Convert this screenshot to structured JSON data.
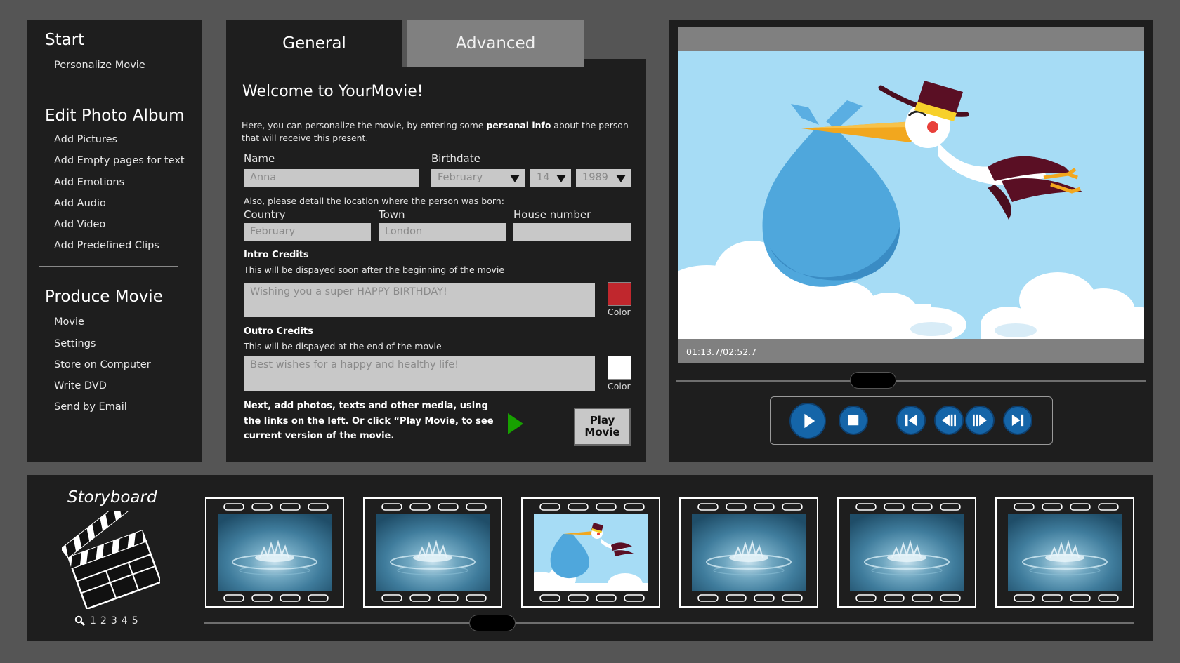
{
  "nav": {
    "start": {
      "title": "Start",
      "items": [
        "Personalize Movie"
      ]
    },
    "album": {
      "title": "Edit Photo Album",
      "items": [
        "Add Pictures",
        "Add Empty pages for text",
        "Add Emotions",
        "Add Audio",
        "Add Video",
        "Add Predefined Clips"
      ]
    },
    "produce": {
      "title": "Produce Movie",
      "items": [
        "Movie",
        "Settings",
        "Store on Computer",
        "Write DVD",
        "Send by Email"
      ]
    }
  },
  "tabs": {
    "general": "General",
    "advanced": "Advanced"
  },
  "form": {
    "welcome": "Welcome to YourMovie!",
    "intro_pre": "Here, you can personalize the movie, by entering some ",
    "intro_bold": "personal info",
    "intro_post": " about the person that will receive this present.",
    "name_label": "Name",
    "name_value": "Anna",
    "birthdate_label": "Birthdate",
    "birth_month": "February",
    "birth_day": "14",
    "birth_year": "1989",
    "location_note": "Also, please detail the location where the person was born:",
    "country_label": "Country",
    "country_value": "February",
    "town_label": "Town",
    "town_value": "London",
    "house_label": "House number",
    "house_value": "",
    "intro_credits_label": "Intro Credits",
    "intro_credits_note": "This will be dispayed soon after the beginning of the movie",
    "intro_credits_text": "Wishing you a super HAPPY BIRTHDAY!",
    "intro_color": "#c0272d",
    "outro_credits_label": "Outro Credits",
    "outro_credits_note": "This will be dispayed at the end of the movie",
    "outro_credits_text": "Best wishes for a happy and healthy life!",
    "outro_color": "#ffffff",
    "color_label": "Color",
    "next_text": "Next, add photos, texts and other media, using the links on the left. Or click “Play Movie, to see current version of the movie.",
    "play_movie_line1": "Play",
    "play_movie_line2": "Movie"
  },
  "player": {
    "time": "01:13.7/02:52.7",
    "position_fraction": 0.41,
    "controls": [
      "play-icon",
      "stop-icon",
      "skip-back-icon",
      "step-back-icon",
      "step-forward-icon",
      "skip-forward-icon"
    ]
  },
  "storyboard": {
    "title": "Storyboard",
    "zoom_levels": [
      "1",
      "2",
      "3",
      "4",
      "5"
    ],
    "frames": [
      "water",
      "water",
      "stork",
      "water",
      "water",
      "water"
    ],
    "scroll_fraction": 0.3
  }
}
